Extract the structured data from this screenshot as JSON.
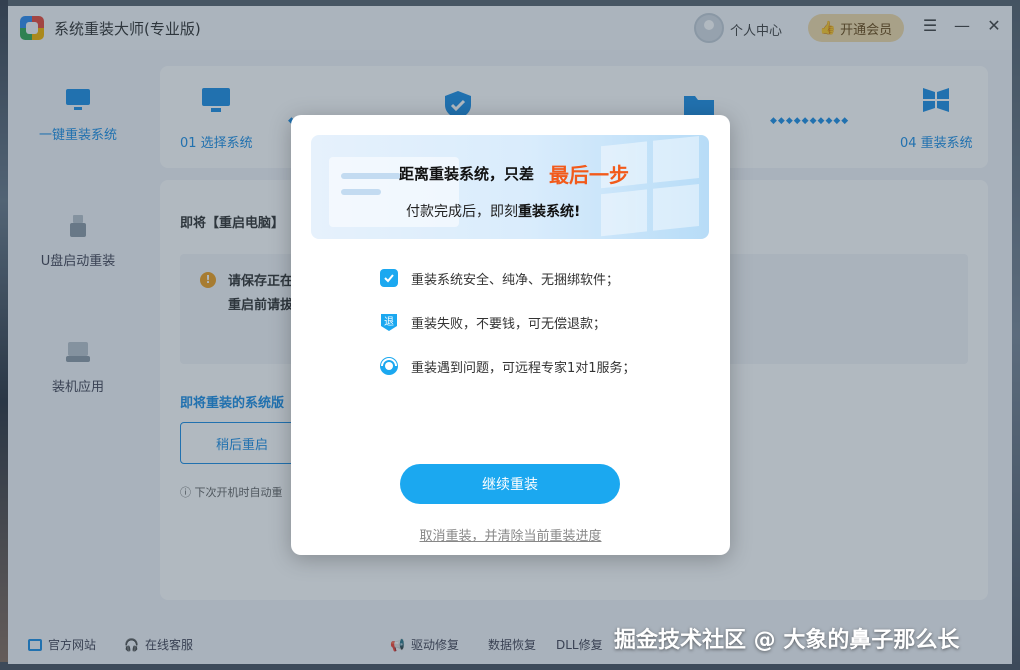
{
  "app": {
    "title": "系统重装大师(专业版)"
  },
  "header": {
    "user_center": "个人中心",
    "vip_button": "开通会员"
  },
  "sidebar": {
    "items": [
      {
        "label": "一键重装系统"
      },
      {
        "label": "U盘启动重装"
      },
      {
        "label": "装机应用"
      }
    ]
  },
  "steps": [
    {
      "label": "01 选择系统"
    },
    {
      "label": "04 重装系统"
    }
  ],
  "main": {
    "restart_title": "即将【重启电脑】",
    "warning_1": "请保存正在",
    "warning_2": "重启前请拔",
    "system_title": "即将重装的系统版",
    "later_button": "稍后重启",
    "auto_note": "下次开机时自动重"
  },
  "footer": {
    "website": "官方网站",
    "support": "在线客服",
    "driver": "驱动修复",
    "data": "数据恢复",
    "dll": "DLL修复"
  },
  "modal": {
    "banner_line1": "距离重装系统，只差",
    "banner_highlight": "最后一步",
    "banner_line2_prefix": "付款完成后，即刻",
    "banner_line2_bold": "重装系统!",
    "features": [
      {
        "text": "重装系统安全、纯净、无捆绑软件；",
        "icon": "shield-icon"
      },
      {
        "text": "重装失败，不要钱，可无偿退款；",
        "icon": "refund-icon"
      },
      {
        "text": "重装遇到问题，可远程专家1对1服务；",
        "icon": "headset-icon"
      }
    ],
    "continue_button": "继续重装",
    "cancel_link": "取消重装，并清除当前重装进度"
  },
  "watermark": "掘金技术社区 @ 大象的鼻子那么长",
  "colors": {
    "accent": "#1ba8f0",
    "highlight": "#f25a1b",
    "vip": "#f1d9a8"
  }
}
